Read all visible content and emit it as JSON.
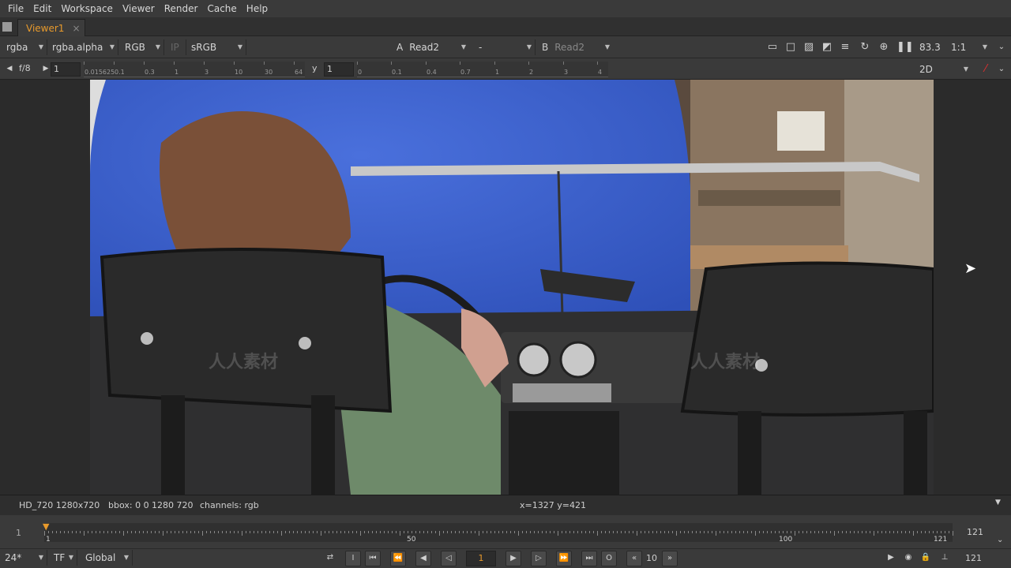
{
  "menu": [
    "File",
    "Edit",
    "Workspace",
    "Viewer",
    "Render",
    "Cache",
    "Help"
  ],
  "tab": {
    "label": "Viewer1",
    "close": "×"
  },
  "toolbar1": {
    "layer": "rgba",
    "alpha": "rgba.alpha",
    "display": "RGB",
    "ip": "IP",
    "lut": "sRGB",
    "a_label": "A",
    "a_input": "Read2",
    "op": "-",
    "b_label": "B",
    "b_input": "Read2",
    "zoom": "83.3",
    "ratio": "1:1"
  },
  "toolbar2": {
    "fstop": "f/8",
    "gain": "1",
    "gamma_label": "y",
    "gamma": "1",
    "mode": "2D",
    "gain_ticks": [
      "0.015625",
      "0.1",
      "0.3",
      "1",
      "3",
      "10",
      "30",
      "64"
    ],
    "gamma_ticks": [
      "0",
      "0.1",
      "0.4",
      "0.7",
      "1",
      "2",
      "3",
      "4"
    ]
  },
  "status": {
    "format": "HD_720 1280x720",
    "bbox": "bbox: 0 0 1280 720",
    "channels": "channels: rgb",
    "coords": "x=1327 y=421"
  },
  "timeline": {
    "start": "1",
    "current": "1",
    "ticks": [
      "1",
      "50",
      "100",
      "121"
    ],
    "end": "121"
  },
  "playbar": {
    "fps": "24*",
    "tf": "TF",
    "scope": "Global",
    "frame": "1",
    "step": "10",
    "end_frame": "121"
  },
  "watermark": "人人素材",
  "colors": {
    "accent": "#e89a2c",
    "bluescreen": "#3d62d0"
  }
}
